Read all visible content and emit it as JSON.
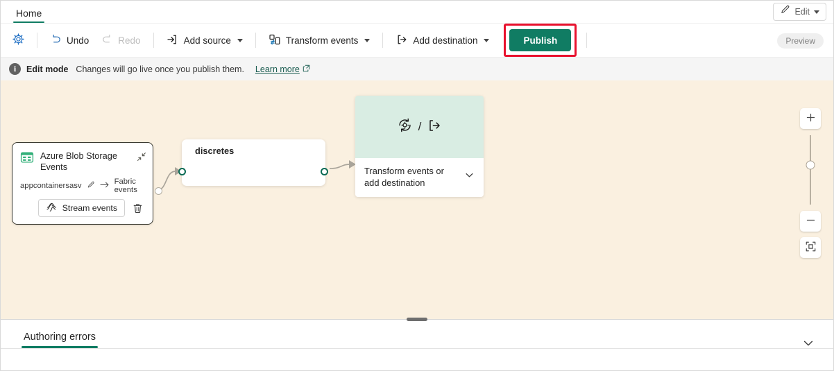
{
  "window": {
    "tab_label": "Home",
    "edit_button": {
      "label": "Edit",
      "icon": "pencil-icon"
    }
  },
  "toolbar": {
    "settings_icon": "gear-icon",
    "undo": {
      "label": "Undo",
      "icon": "undo-arrow-icon",
      "disabled": false
    },
    "redo": {
      "label": "Redo",
      "icon": "redo-arrow-icon",
      "disabled": true
    },
    "add_source": {
      "label": "Add source",
      "icon": "arrow-into-bracket-icon"
    },
    "transform_events": {
      "label": "Transform events",
      "icon": "transform-icon"
    },
    "add_destination": {
      "label": "Add destination",
      "icon": "arrow-out-of-bracket-icon"
    },
    "publish": {
      "label": "Publish",
      "highlight_color": "#e8112d",
      "background": "#107c63"
    },
    "preview_badge": "Preview"
  },
  "info_bar": {
    "icon": "info-icon",
    "title": "Edit mode",
    "message": "Changes will go live once you publish them.",
    "link": "Learn more",
    "link_icon": "external-link-icon"
  },
  "canvas": {
    "background": "#faf0e0",
    "nodes": {
      "source": {
        "icon": "azure-blob-storage-icon",
        "title": "Azure Blob Storage Events",
        "expand_icon": "collapse-diagonal-icon",
        "meta_name": "appcontainersasv",
        "meta_edit_icon": "pencil-icon",
        "meta_arrow_icon": "arrow-right-icon",
        "meta_target": "Fabric events",
        "stream_button": {
          "label": "Stream events",
          "icon": "stream-icon"
        },
        "delete_icon": "trash-icon"
      },
      "middle": {
        "title": "discretes"
      },
      "destination": {
        "transform_icon": "transform-circular-icon",
        "separator": "/",
        "destination_icon": "arrow-out-of-bracket-icon",
        "label": "Transform events or add destination",
        "chevron_icon": "chevron-down-icon"
      }
    },
    "zoom_controls": {
      "zoom_in_icon": "plus-icon",
      "zoom_out_icon": "minus-icon",
      "fit_to_screen_icon": "fit-screen-icon",
      "slider_handle": "zoom-slider-thumb"
    }
  },
  "bottom_panel": {
    "tab_label": "Authoring errors",
    "collapse_icon": "chevron-down-icon",
    "accent_color": "#107c63"
  }
}
